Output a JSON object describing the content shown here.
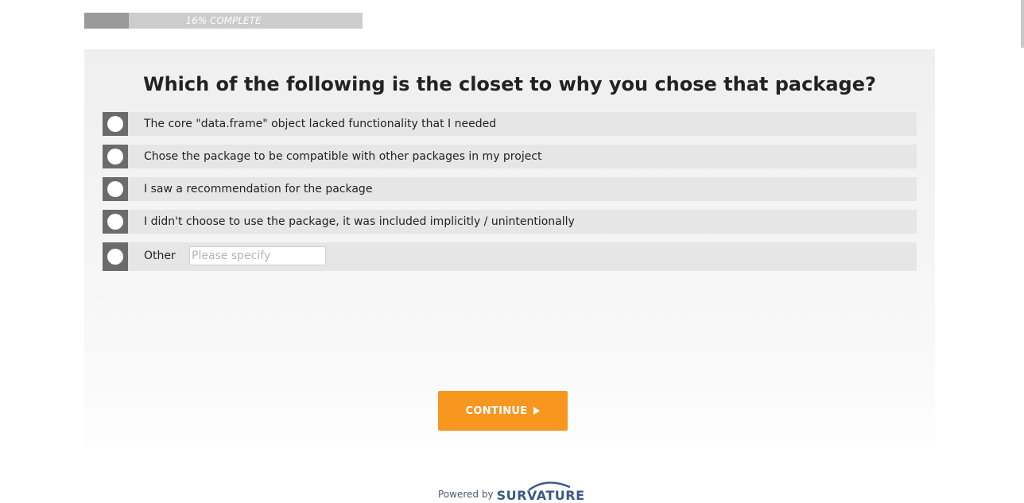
{
  "progress": {
    "label": "16% COMPLETE",
    "percent": 16
  },
  "question": {
    "title": "Which of the following is the closet to why you chose that package?"
  },
  "options": [
    {
      "label": "The core \"data.frame\" object lacked functionality that I needed"
    },
    {
      "label": "Chose the package to be compatible with other packages in my project"
    },
    {
      "label": "I saw a recommendation for the package"
    },
    {
      "label": "I didn't choose to use the package, it was included implicitly / unintentionally"
    },
    {
      "label": "Other"
    }
  ],
  "other_input": {
    "value": "",
    "placeholder": "Please specify"
  },
  "continue_button": {
    "label": "CONTINUE",
    "icon": "play-icon"
  },
  "footer": {
    "powered_by": "Powered by",
    "brand": "SURVATURE"
  },
  "colors": {
    "accent": "#f7971f",
    "radio_box": "#6b6b6b",
    "option_bg": "#e6e6e6",
    "progress_track": "#cccccc",
    "progress_fill": "#999999",
    "brand": "#3a5a85"
  }
}
